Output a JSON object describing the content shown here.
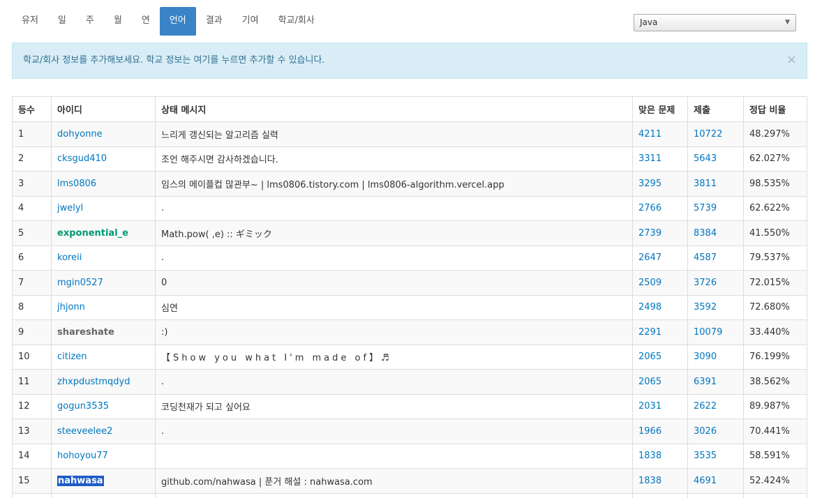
{
  "tabs": [
    {
      "label": "유저",
      "active": false
    },
    {
      "label": "일",
      "active": false
    },
    {
      "label": "주",
      "active": false
    },
    {
      "label": "월",
      "active": false
    },
    {
      "label": "연",
      "active": false
    },
    {
      "label": "언어",
      "active": true
    },
    {
      "label": "결과",
      "active": false
    },
    {
      "label": "기여",
      "active": false
    },
    {
      "label": "학교/회사",
      "active": false
    }
  ],
  "language_select": {
    "value": "Java"
  },
  "alert": {
    "text": "학교/회사 정보를 추가해보세요. 학교 정보는 여기를 누르면 추가할 수 있습니다.",
    "close": "×"
  },
  "table": {
    "headers": [
      "등수",
      "아이디",
      "상태 메시지",
      "맞은 문제",
      "제출",
      "정답 비율"
    ],
    "rows": [
      {
        "rank": "1",
        "id": "dohyonne",
        "status": "느리게 갱신되는 알고리즘 실력",
        "solved": "4211",
        "submissions": "10722",
        "ratio": "48.297%"
      },
      {
        "rank": "2",
        "id": "cksgud410",
        "status": "조언 해주시면 감사하겠습니다.",
        "solved": "3311",
        "submissions": "5643",
        "ratio": "62.027%"
      },
      {
        "rank": "3",
        "id": "lms0806",
        "status": "임스의 메이플컵 많관부~ | lms0806.tistory.com | lms0806-algorithm.vercel.app",
        "solved": "3295",
        "submissions": "3811",
        "ratio": "98.535%"
      },
      {
        "rank": "4",
        "id": "jwelyl",
        "status": ".",
        "solved": "2766",
        "submissions": "5739",
        "ratio": "62.622%"
      },
      {
        "rank": "5",
        "id": "exponential_e",
        "status": "Math.pow( ,e) :: ギミック",
        "solved": "2739",
        "submissions": "8384",
        "ratio": "41.550%"
      },
      {
        "rank": "6",
        "id": "koreii",
        "status": ".",
        "solved": "2647",
        "submissions": "4587",
        "ratio": "79.537%"
      },
      {
        "rank": "7",
        "id": "mgin0527",
        "status": "0",
        "solved": "2509",
        "submissions": "3726",
        "ratio": "72.015%"
      },
      {
        "rank": "8",
        "id": "jhjonn",
        "status": "심연",
        "solved": "2498",
        "submissions": "3592",
        "ratio": "72.680%"
      },
      {
        "rank": "9",
        "id": "shareshate",
        "status": ":)",
        "solved": "2291",
        "submissions": "10079",
        "ratio": "33.440%"
      },
      {
        "rank": "10",
        "id": "citizen",
        "status": "【Show you what I'm made of】♬",
        "solved": "2065",
        "submissions": "3090",
        "ratio": "76.199%"
      },
      {
        "rank": "11",
        "id": "zhxpdustmqdyd",
        "status": ".",
        "solved": "2065",
        "submissions": "6391",
        "ratio": "38.562%"
      },
      {
        "rank": "12",
        "id": "gogun3535",
        "status": "코딩천재가 되고 싶어요",
        "solved": "2031",
        "submissions": "2622",
        "ratio": "89.987%"
      },
      {
        "rank": "13",
        "id": "steeveelee2",
        "status": ".",
        "solved": "1966",
        "submissions": "3026",
        "ratio": "70.441%"
      },
      {
        "rank": "14",
        "id": "hohoyou77",
        "status": "",
        "solved": "1838",
        "submissions": "3535",
        "ratio": "58.591%"
      },
      {
        "rank": "15",
        "id": "nahwasa",
        "status": "github.com/nahwasa | 푼거 해설 : nahwasa.com",
        "solved": "1838",
        "submissions": "4691",
        "ratio": "52.424%"
      }
    ]
  },
  "colors": {
    "active_tab": "#3a83c6",
    "link": "#0076c0",
    "alert_bg": "#d9edf7",
    "alert_text": "#31708f",
    "green_user": "#009874",
    "gray_user": "#666666",
    "selection": "#1e5bc6"
  }
}
